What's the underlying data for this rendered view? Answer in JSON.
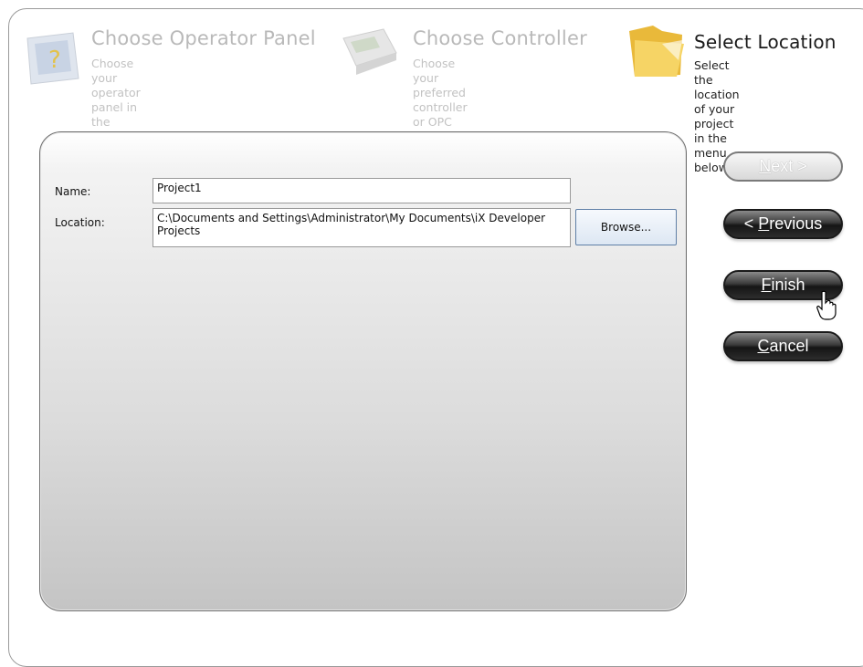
{
  "steps": [
    {
      "title": "Choose Operator Panel",
      "description": "Choose your operator panel in the\nmenu below",
      "icon": "operator-panel-icon"
    },
    {
      "title": "Choose Controller",
      "description": "Choose your preferred controller\nor OPC server in the menu below",
      "icon": "controller-icon"
    },
    {
      "title": "Select Location",
      "description": "Select the location of your\nproject in the menu below",
      "icon": "folder-icon"
    }
  ],
  "form": {
    "name_label": "Name:",
    "name_value": "Project1",
    "location_label": "Location:",
    "location_value": "C:\\Documents and Settings\\Administrator\\My Documents\\iX Developer Projects",
    "browse_label": "Browse..."
  },
  "buttons": {
    "next": {
      "mnemonic": "N",
      "rest": "ext >"
    },
    "previous": {
      "prefix": "< ",
      "mnemonic": "P",
      "rest": "revious"
    },
    "finish": {
      "mnemonic": "F",
      "rest": "inish"
    },
    "cancel": {
      "mnemonic": "C",
      "rest": "ancel"
    }
  },
  "colors": {
    "inactive_text": "#b9b9b9",
    "active_text": "#1a1a1a",
    "button_dark": "#1a1a1a",
    "folder": "#f2c84b"
  }
}
